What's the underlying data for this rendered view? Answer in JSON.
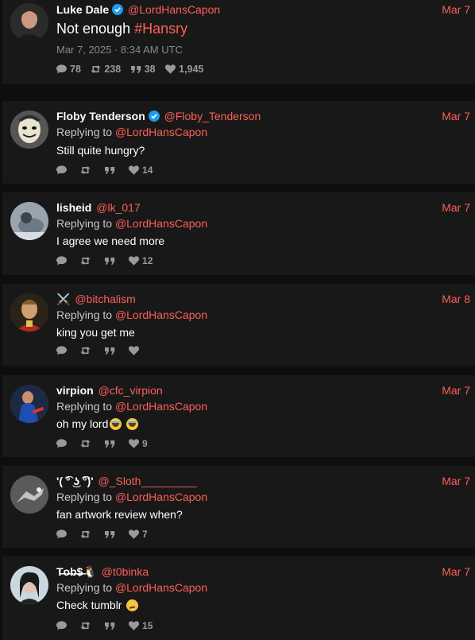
{
  "main": {
    "display_name": "Luke Dale",
    "handle": "@LordHansCapon",
    "date": "Mar 7",
    "text_prefix": "Not enough ",
    "hashtag": "#Hansry",
    "timestamp": "Mar 7, 2025 · 8:34 AM UTC",
    "stats": {
      "comments": "78",
      "retweets": "238",
      "quotes": "38",
      "likes": "1,945"
    }
  },
  "replying_to_label": "Replying to ",
  "replies": [
    {
      "display_name": "Floby Tenderson",
      "verified": true,
      "handle": "@Floby_Tenderson",
      "date": "Mar 7",
      "reply_to": "@LordHansCapon",
      "text": "Still quite hungry?",
      "likes": "14"
    },
    {
      "display_name": "lisheid",
      "verified": false,
      "handle": "@lk_017",
      "date": "Mar 7",
      "reply_to": "@LordHansCapon",
      "text": "I agree we need more",
      "likes": "12"
    },
    {
      "display_name": "⚔️",
      "verified": false,
      "handle": "@bitchalism",
      "date": "Mar 8",
      "reply_to": "@LordHansCapon",
      "text": "king you get me",
      "likes": ""
    },
    {
      "display_name": "virpion",
      "verified": false,
      "handle": "@cfc_virpion",
      "date": "Mar 7",
      "reply_to": "@LordHansCapon",
      "text": "oh my lord",
      "likes": "9"
    },
    {
      "display_name": "'( ͡° ͜ʖ ͡°)'",
      "verified": false,
      "handle": "@_Sloth_________",
      "date": "Mar 7",
      "reply_to": "@LordHansCapon",
      "text": "fan artwork review when?",
      "likes": "7"
    },
    {
      "display_name": "T̶o̶b̶$̶🐧",
      "verified": false,
      "handle": "@t0binka",
      "date": "Mar 7",
      "reply_to": "@LordHansCapon",
      "text": "Check tumblr",
      "likes": "15"
    }
  ],
  "colors": {
    "accent": "#ff5f57",
    "background": "#0e0e0e",
    "card": "#181818",
    "verified": "#1d9bf0"
  },
  "icons": [
    "comment-icon",
    "retweet-icon",
    "quote-icon",
    "heart-icon",
    "verified-badge-icon"
  ]
}
